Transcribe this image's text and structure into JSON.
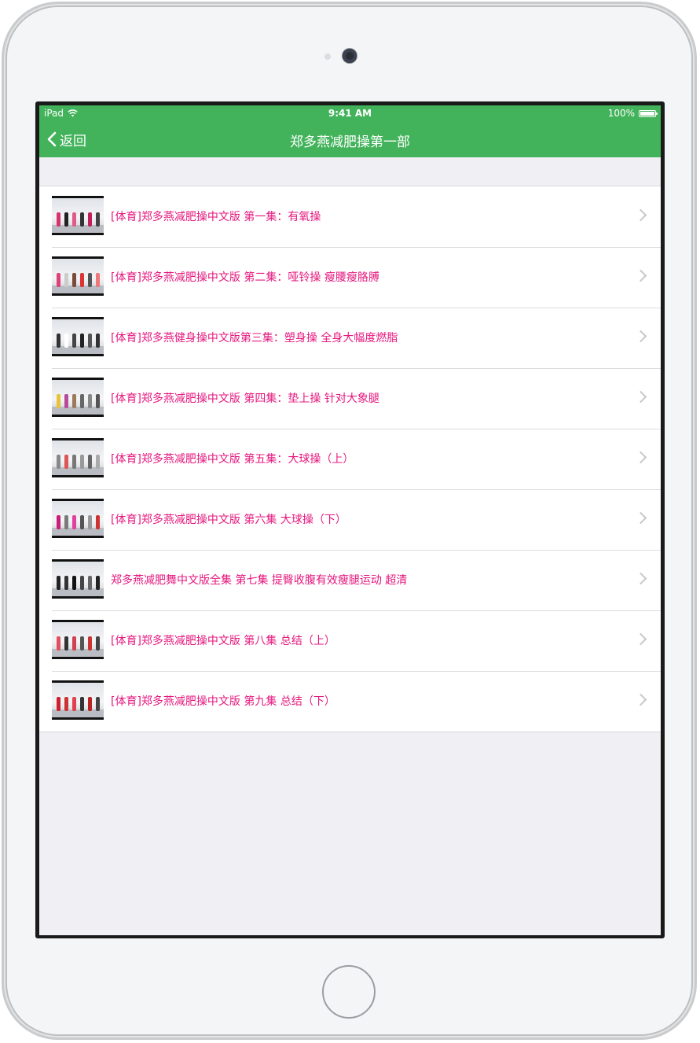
{
  "status_bar": {
    "carrier": "iPad",
    "time": "9:41 AM",
    "battery": "100%"
  },
  "nav": {
    "back_label": "返回",
    "title": "郑多燕减肥操第一部"
  },
  "episodes": [
    {
      "title": "[体育]郑多燕减肥操中文版 第一集：有氧操"
    },
    {
      "title": "[体育]郑多燕减肥操中文版 第二集：哑铃操 瘦腰瘦胳膊"
    },
    {
      "title": "[体育]郑多燕健身操中文版第三集：塑身操 全身大幅度燃脂"
    },
    {
      "title": "[体育]郑多燕减肥操中文版 第四集：垫上操 针对大象腿"
    },
    {
      "title": "[体育]郑多燕减肥操中文版 第五集：大球操（上）"
    },
    {
      "title": "[体育]郑多燕减肥操中文版 第六集 大球操（下）"
    },
    {
      "title": "郑多燕减肥舞中文版全集 第七集 提臀收腹有效瘦腿运动 超清"
    },
    {
      "title": "[体育]郑多燕减肥操中文版 第八集 总结（上）"
    },
    {
      "title": "[体育]郑多燕减肥操中文版 第九集 总结（下）"
    }
  ],
  "colors": {
    "nav_bar": "#42b35b",
    "item_text": "#e5177e",
    "background": "#efeff4"
  }
}
